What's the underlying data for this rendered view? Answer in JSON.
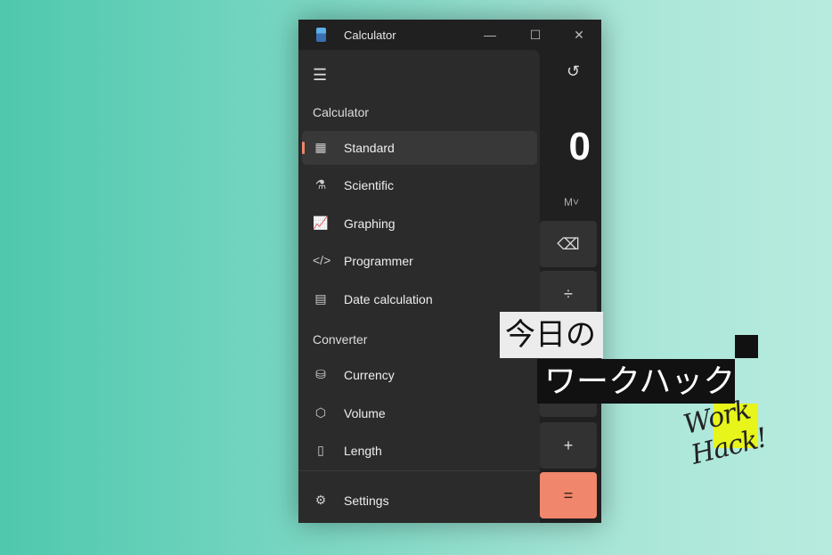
{
  "window": {
    "title": "Calculator",
    "minimize": "—",
    "maximize": "☐",
    "close": "✕"
  },
  "nav": {
    "menu_icon": "☰",
    "calculator_header": "Calculator",
    "calculator_items": [
      {
        "label": "Standard",
        "icon": "▦",
        "active": true
      },
      {
        "label": "Scientific",
        "icon": "⚗"
      },
      {
        "label": "Graphing",
        "icon": "📈"
      },
      {
        "label": "Programmer",
        "icon": "</>"
      },
      {
        "label": "Date calculation",
        "icon": "▤"
      }
    ],
    "converter_header": "Converter",
    "converter_items": [
      {
        "label": "Currency",
        "icon": "⛁"
      },
      {
        "label": "Volume",
        "icon": "⬡"
      },
      {
        "label": "Length",
        "icon": "▯"
      }
    ],
    "settings": {
      "label": "Settings",
      "icon": "⚙"
    }
  },
  "display": {
    "value": "0",
    "memory": "M˅",
    "history_icon": "↺"
  },
  "keys": [
    "⌫",
    "÷",
    "+",
    "="
  ],
  "colors": {
    "accent": "#f0866b",
    "highlight": "#e8f51a"
  },
  "overlay": {
    "line1": "今日の",
    "line2": "ワークハック",
    "signature": "Work Hack!"
  }
}
